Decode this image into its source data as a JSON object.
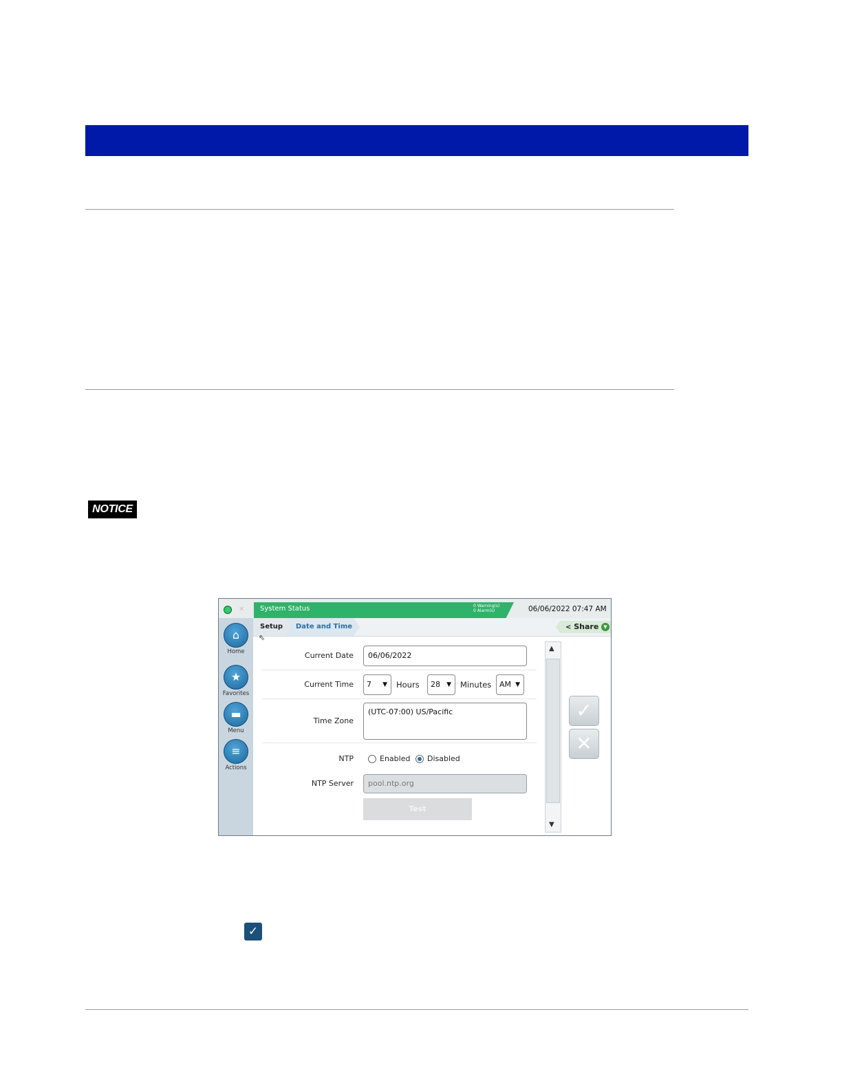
{
  "notice": {
    "label": "NOTICE"
  },
  "screen": {
    "topbar": {
      "status": "System Status",
      "warnings": "0 Warning(s)",
      "alarms": "0 Alarm(s)",
      "datetime": "06/06/2022 07:47 AM"
    },
    "breadcrumb": {
      "setup": "Setup",
      "current": "Date and Time"
    },
    "share": {
      "label": "Share"
    },
    "sidebar": {
      "items": [
        {
          "label": "Home",
          "icon": "home-icon"
        },
        {
          "label": "Favorites",
          "icon": "star-icon"
        },
        {
          "label": "Menu",
          "icon": "menu-icon"
        },
        {
          "label": "Actions",
          "icon": "actions-icon"
        }
      ]
    },
    "form": {
      "current_date_label": "Current Date",
      "current_date_value": "06/06/2022",
      "current_time_label": "Current Time",
      "hours_value": "7",
      "hours_label": "Hours",
      "minutes_value": "28",
      "minutes_label": "Minutes",
      "ampm_value": "AM",
      "time_zone_label": "Time Zone",
      "time_zone_value": "(UTC-07:00) US/Pacific",
      "ntp_label": "NTP",
      "ntp_enabled": "Enabled",
      "ntp_disabled": "Disabled",
      "ntp_selected": "Disabled",
      "ntp_server_label": "NTP Server",
      "ntp_server_value": "pool.ntp.org",
      "test_button": "Test"
    }
  },
  "colors": {
    "banner": "#0019a8",
    "status_green": "#2fb36a",
    "accent_blue": "#2a6fa3",
    "checkbox": "#1c4f7a"
  }
}
